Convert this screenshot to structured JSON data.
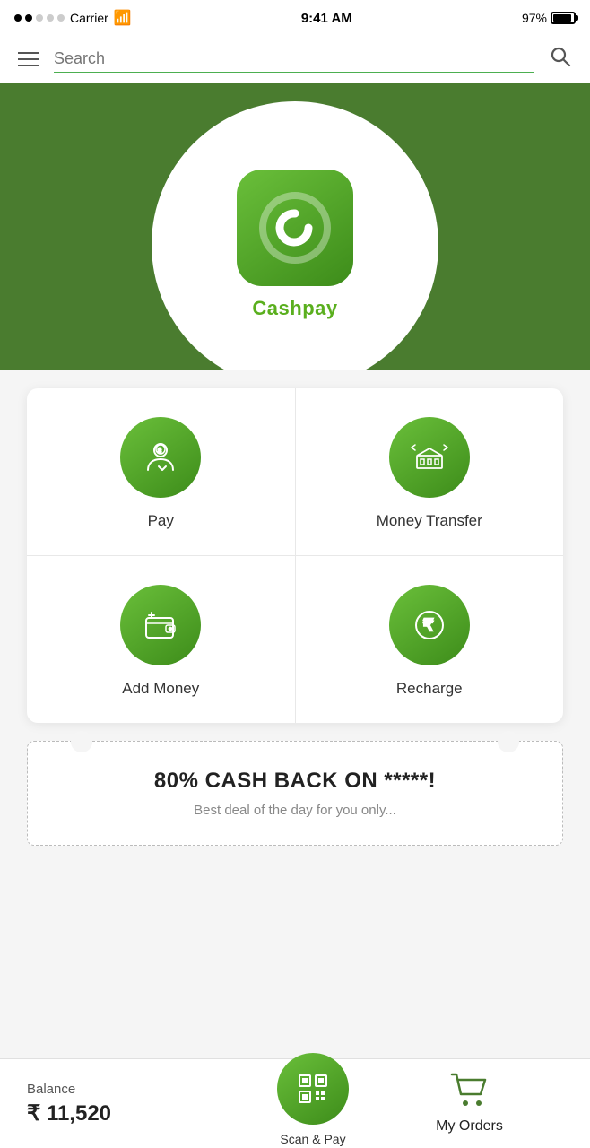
{
  "statusBar": {
    "carrier": "Carrier",
    "time": "9:41 AM",
    "battery": "97%"
  },
  "searchBar": {
    "placeholder": "Search"
  },
  "hero": {
    "appName": "Cashpay"
  },
  "grid": {
    "items": [
      {
        "id": "pay",
        "label": "Pay",
        "icon": "pay-icon"
      },
      {
        "id": "money-transfer",
        "label": "Money Transfer",
        "icon": "money-transfer-icon"
      },
      {
        "id": "add-money",
        "label": "Add Money",
        "icon": "add-money-icon"
      },
      {
        "id": "recharge",
        "label": "Recharge",
        "icon": "recharge-icon"
      }
    ]
  },
  "promo": {
    "title": "80% CASH BACK ON *****!",
    "subtitle": "Best deal of the day for you only..."
  },
  "bottomBar": {
    "balanceLabel": "Balance",
    "balanceAmount": "₹ 11,520",
    "scanLabel": "Scan & Pay",
    "ordersLabel": "My Orders"
  }
}
